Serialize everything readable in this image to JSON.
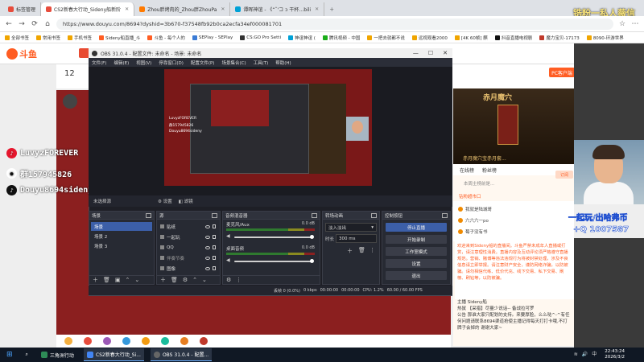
{
  "browser": {
    "tabs": [
      {
        "label": "标签管理",
        "active": false
      },
      {
        "label": "CS2新春大行动_Sideny船新阶",
        "active": true
      },
      {
        "label": "Zhou胖烤肉的_Zhou胖ZhouPa",
        "active": false
      },
      {
        "label": "谭晖神谊 - 《“ˇ'コ ɔ 干杯…bili",
        "active": false
      }
    ],
    "url": "https://www.douyu.com/8694?dyshid=3b670-f37548fb92b0ca2ecfa34ef000081701",
    "bookmarks": [
      "全部书签",
      "常用书签",
      "手机书签",
      "Sideny船直播_斗",
      "斗鱼 - 每个人的",
      "SEPlay - SEPlay",
      "CS:GO Pro Setti",
      "神谊神谊 (",
      "",
      "腾讯视频 - 中国",
      "一把去就都不说",
      "远视观看2000",
      "[4K 60帧] 麒",
      "抖音直播电视剧",
      "魔力宝贝-17173",
      "8090-环游世界"
    ]
  },
  "overlay": {
    "brand_top": "锆粉一私人薇信",
    "social_weibo": "LuvyzFOREVER",
    "social_qq": "群157945826",
    "social_douyin": "Douyu8694sideny",
    "promo_line": "一起玩/出哈弗币",
    "promo_qq": "+Q 1007587"
  },
  "douyu": {
    "room_number": "12",
    "pc_label": "PC客户端",
    "ad_title": "赤月魔穴",
    "ad_caption": "赤月魔穴宝赤月套...",
    "chat_tabs": [
      "在线榜",
      "粉丝榜"
    ],
    "chat_tab_note": "本周主榜前是...",
    "subscribe": "订阅",
    "fan_group": "钻粉超市口",
    "chat_list": [
      "我就是陆城哥",
      "六六六一po",
      "莓子没有书"
    ],
    "notice": "欢迎来到Sideny船的直播间。斗鱼严禁未成年人直播或打赏，请注意理性消费。直播内容及互动评论须严格遵守直播规范。营销、赌博等违法违规行为将被封禁处理，涉及不良信息请立即举报。请注意财产安全，谨防网络诈骗，以防被骗。请勿相信代练、低价代充、线下交易、私下交易、刷榜、刷钻等，以防被骗。",
    "messages": [
      "主播  Sideny船",
      "热鼠 【采猎】尽量少说话-- 备战拉可罗",
      "公告  那谁大家只配划的支持。来要厚脸，么么哒^-^有任何问题请联系8694渠道抢使主播记得每天打打卡哦,不打牌子会掉的 谢谢大家~"
    ]
  },
  "obs": {
    "title": "OBS 31.0.4 - 配置文件: 未命名 - 场景: 未命名",
    "menu": [
      "文件(F)",
      "编辑(E)",
      "视图(V)",
      "停靠窗口(D)",
      "场景集(S)",
      "配置文件(P)",
      "场景集合(C)",
      "工具(T)",
      "帮助(H)"
    ],
    "source_bar": [
      "未选择源",
      "设置",
      "滤镜"
    ],
    "docks": {
      "scenes": "场景",
      "sources": "源",
      "mixer": "音频混音器",
      "transitions": "转场动画",
      "controls": "控制按钮"
    },
    "scenes": [
      "场景",
      "场景 2",
      "场景 3"
    ],
    "sources": [
      "贴纸",
      "一起玩",
      "QQ",
      "伴奏节奏",
      "图像"
    ],
    "mixer": [
      {
        "label": "麦克风/Aux",
        "db": "0.0 dB",
        "level": 0.72
      },
      {
        "label": "桌面音频",
        "db": "0.0 dB",
        "level": 0.55
      }
    ],
    "transition_type": "淡入淡出",
    "duration_label": "时长",
    "duration_value": "300 ms",
    "controls": [
      "停止直播",
      "开始录制",
      "工作室模式",
      "设置",
      "退出"
    ],
    "status": [
      "丢帧 0 (0.0%)",
      "0 kbps",
      "00:00:00",
      "00:00:00",
      "CPU: 1.2%",
      "60.00 / 60.00 FPS"
    ],
    "preview_social": [
      "LuvyzFOREVER",
      "群157945826",
      "Douyu8694sideny"
    ]
  },
  "taskbar": {
    "items": [
      "三角洲行动",
      "CS2新春大行动_Si...",
      "OBS 31.0.4 - 配置..."
    ],
    "time": "22:43:24",
    "date": "2026/3/2"
  }
}
